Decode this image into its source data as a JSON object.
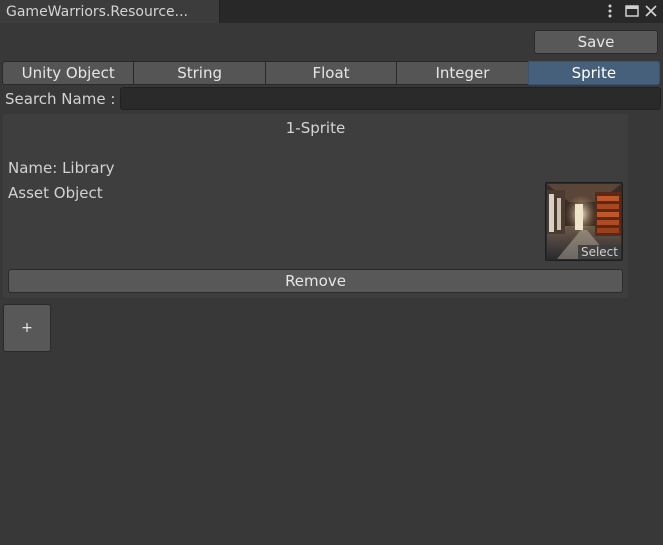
{
  "window": {
    "tab_title": "GameWarriors.Resource...",
    "menu_icon": "kebab-menu-icon",
    "maximize_icon": "maximize-icon",
    "close_icon": "close-icon"
  },
  "toolbar": {
    "save_label": "Save"
  },
  "type_tabs": [
    {
      "label": "Unity Object",
      "active": false
    },
    {
      "label": "String",
      "active": false
    },
    {
      "label": "Float",
      "active": false
    },
    {
      "label": "Integer",
      "active": false
    },
    {
      "label": "Sprite",
      "active": true
    }
  ],
  "search": {
    "label": "Search Name :",
    "value": "",
    "placeholder": ""
  },
  "entries": [
    {
      "title": "1-Sprite",
      "name_line": "Name: Library",
      "asset_label": "Asset Object",
      "sprite_select_label": "Select",
      "remove_label": "Remove"
    }
  ],
  "add_button_label": "+",
  "colors": {
    "background": "#383838",
    "active_tab": "#46607c",
    "button": "#585858",
    "titlebar": "#282828"
  }
}
